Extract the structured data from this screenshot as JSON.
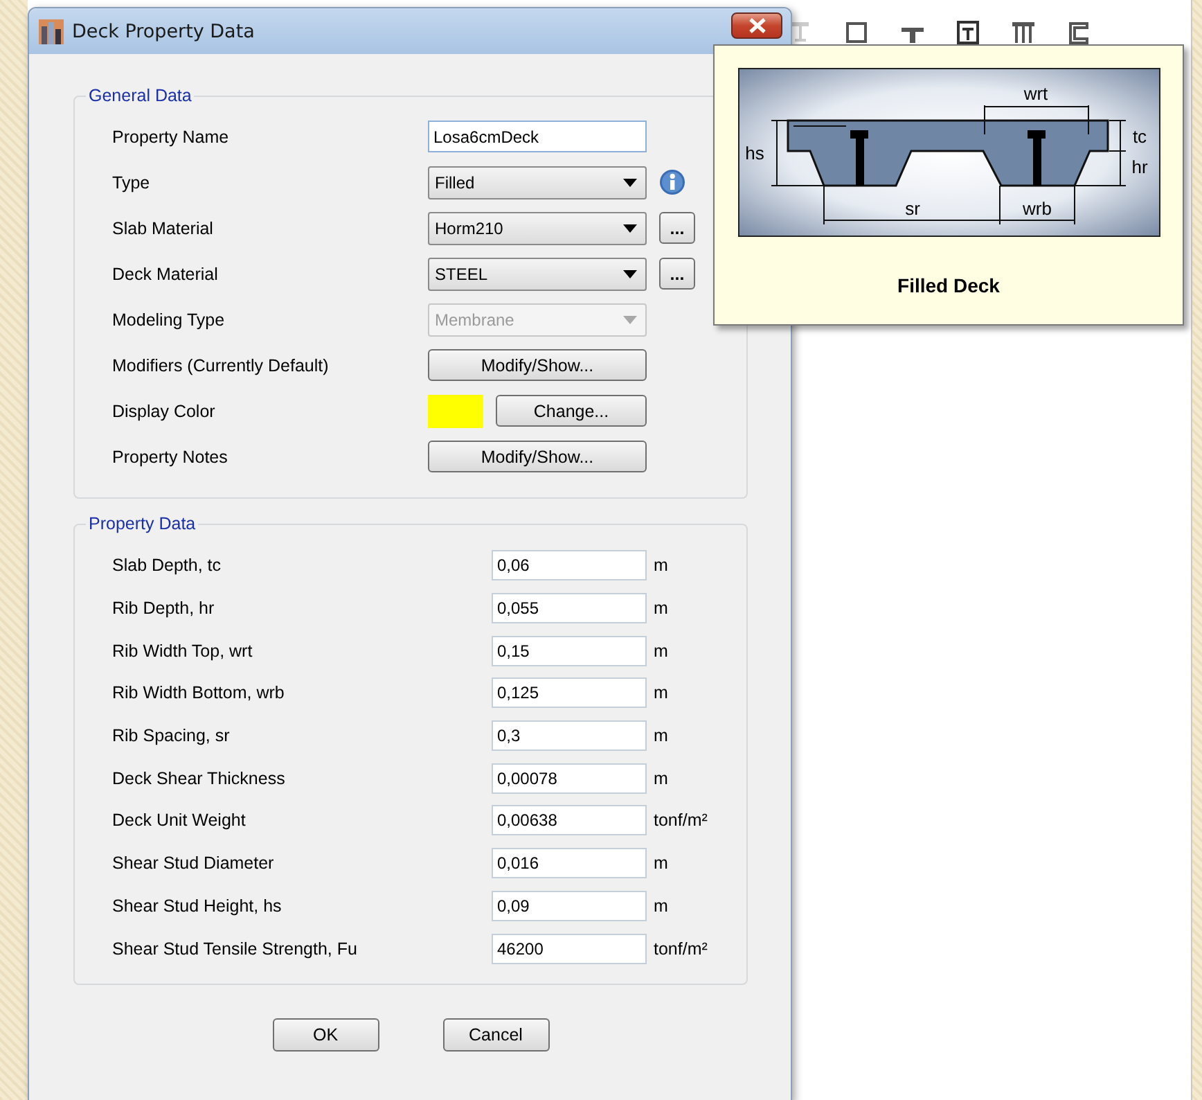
{
  "window": {
    "title": "Deck Property Data"
  },
  "general_data": {
    "title": "General Data",
    "rows": [
      {
        "label": "Property Name",
        "kind": "text",
        "value": "Losa6cmDeck"
      },
      {
        "label": "Type",
        "kind": "dropdown",
        "value": "Filled",
        "disabled": false,
        "info": true
      },
      {
        "label": "Slab Material",
        "kind": "dropdown",
        "value": "Horm210",
        "disabled": false,
        "browse": "..."
      },
      {
        "label": "Deck Material",
        "kind": "dropdown",
        "value": "STEEL",
        "disabled": false,
        "browse": "..."
      },
      {
        "label": "Modeling Type",
        "kind": "dropdown",
        "value": "Membrane",
        "disabled": true
      },
      {
        "label": "Modifiers (Currently Default)",
        "kind": "button",
        "value": "Modify/Show..."
      },
      {
        "label": "Display Color",
        "kind": "color",
        "color": "#ffff00",
        "value": "Change..."
      },
      {
        "label": "Property Notes",
        "kind": "button",
        "value": "Modify/Show..."
      }
    ]
  },
  "property_data": {
    "title": "Property Data",
    "rows": [
      {
        "label": "Slab Depth, tc",
        "value": "0,06",
        "unit": "m"
      },
      {
        "label": "Rib Depth, hr",
        "value": "0,055",
        "unit": "m"
      },
      {
        "label": "Rib Width Top, wrt",
        "value": "0,15",
        "unit": "m"
      },
      {
        "label": "Rib Width Bottom, wrb",
        "value": "0,125",
        "unit": "m"
      },
      {
        "label": "Rib Spacing, sr",
        "value": "0,3",
        "unit": "m"
      },
      {
        "label": "Deck Shear Thickness",
        "value": "0,00078",
        "unit": "m"
      },
      {
        "label": "Deck Unit Weight",
        "value": "0,00638",
        "unit": "tonf/m²"
      },
      {
        "label": "Shear Stud Diameter",
        "value": "0,016",
        "unit": "m"
      },
      {
        "label": "Shear Stud Height, hs",
        "value": "0,09",
        "unit": "m"
      },
      {
        "label": "Shear Stud Tensile Strength, Fu",
        "value": "46200",
        "unit": "tonf/m²"
      }
    ]
  },
  "buttons": [
    "OK",
    "Cancel"
  ],
  "tooltip": {
    "caption": "Filled Deck",
    "dimension_labels": [
      "wrt",
      "tc",
      "hr",
      "hs",
      "sr",
      "wrb"
    ]
  }
}
